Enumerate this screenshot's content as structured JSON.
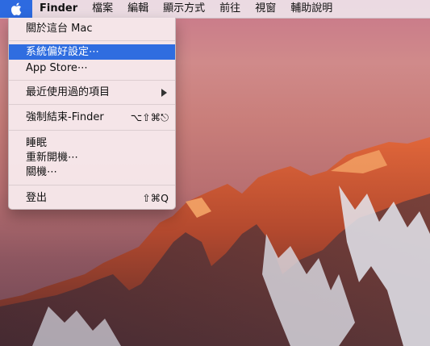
{
  "menubar": {
    "apple_menu": "apple-icon",
    "app_name": "Finder",
    "menus": [
      "檔案",
      "編輯",
      "顯示方式",
      "前往",
      "視窗",
      "輔助說明"
    ]
  },
  "apple_menu": {
    "about": "關於這台 Mac",
    "system_prefs": "系統偏好設定⋯",
    "app_store": "App Store⋯",
    "recent_items": "最近使用過的項目",
    "force_quit": "強制結束-Finder",
    "force_quit_shortcut": "⌥⇧⌘⎋",
    "sleep": "睡眠",
    "restart": "重新開機⋯",
    "shutdown": "關機⋯",
    "logout": "登出",
    "logout_shortcut": "⇧⌘Q"
  },
  "colors": {
    "highlight": "#2f6de0"
  }
}
